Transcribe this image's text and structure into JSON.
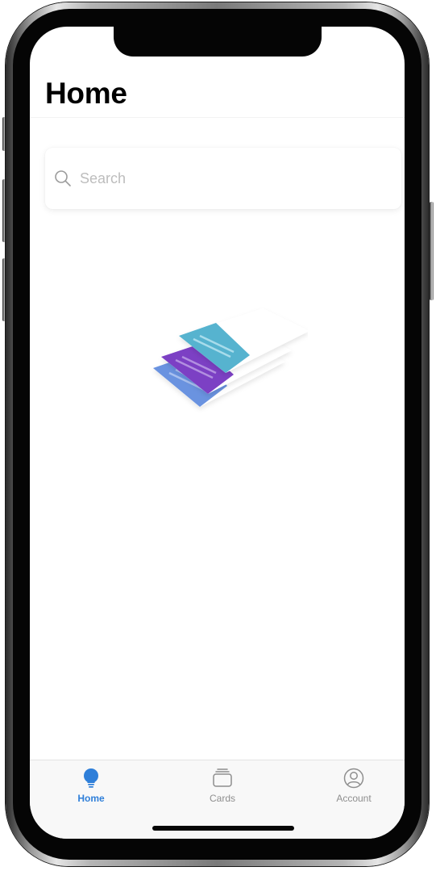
{
  "header": {
    "title": "Home"
  },
  "search": {
    "placeholder": "Search",
    "value": ""
  },
  "tabbar": {
    "items": [
      {
        "label": "Home",
        "icon": "lightbulb-icon",
        "active": true
      },
      {
        "label": "Cards",
        "icon": "cards-stack-icon",
        "active": false
      },
      {
        "label": "Account",
        "icon": "account-circle-icon",
        "active": false
      }
    ]
  },
  "colors": {
    "accent": "#2f7fd9",
    "inactive": "#8e8e8e",
    "card_teal": "#56b3cf",
    "card_purple": "#7b3fc4",
    "card_blue": "#6b93e0"
  }
}
